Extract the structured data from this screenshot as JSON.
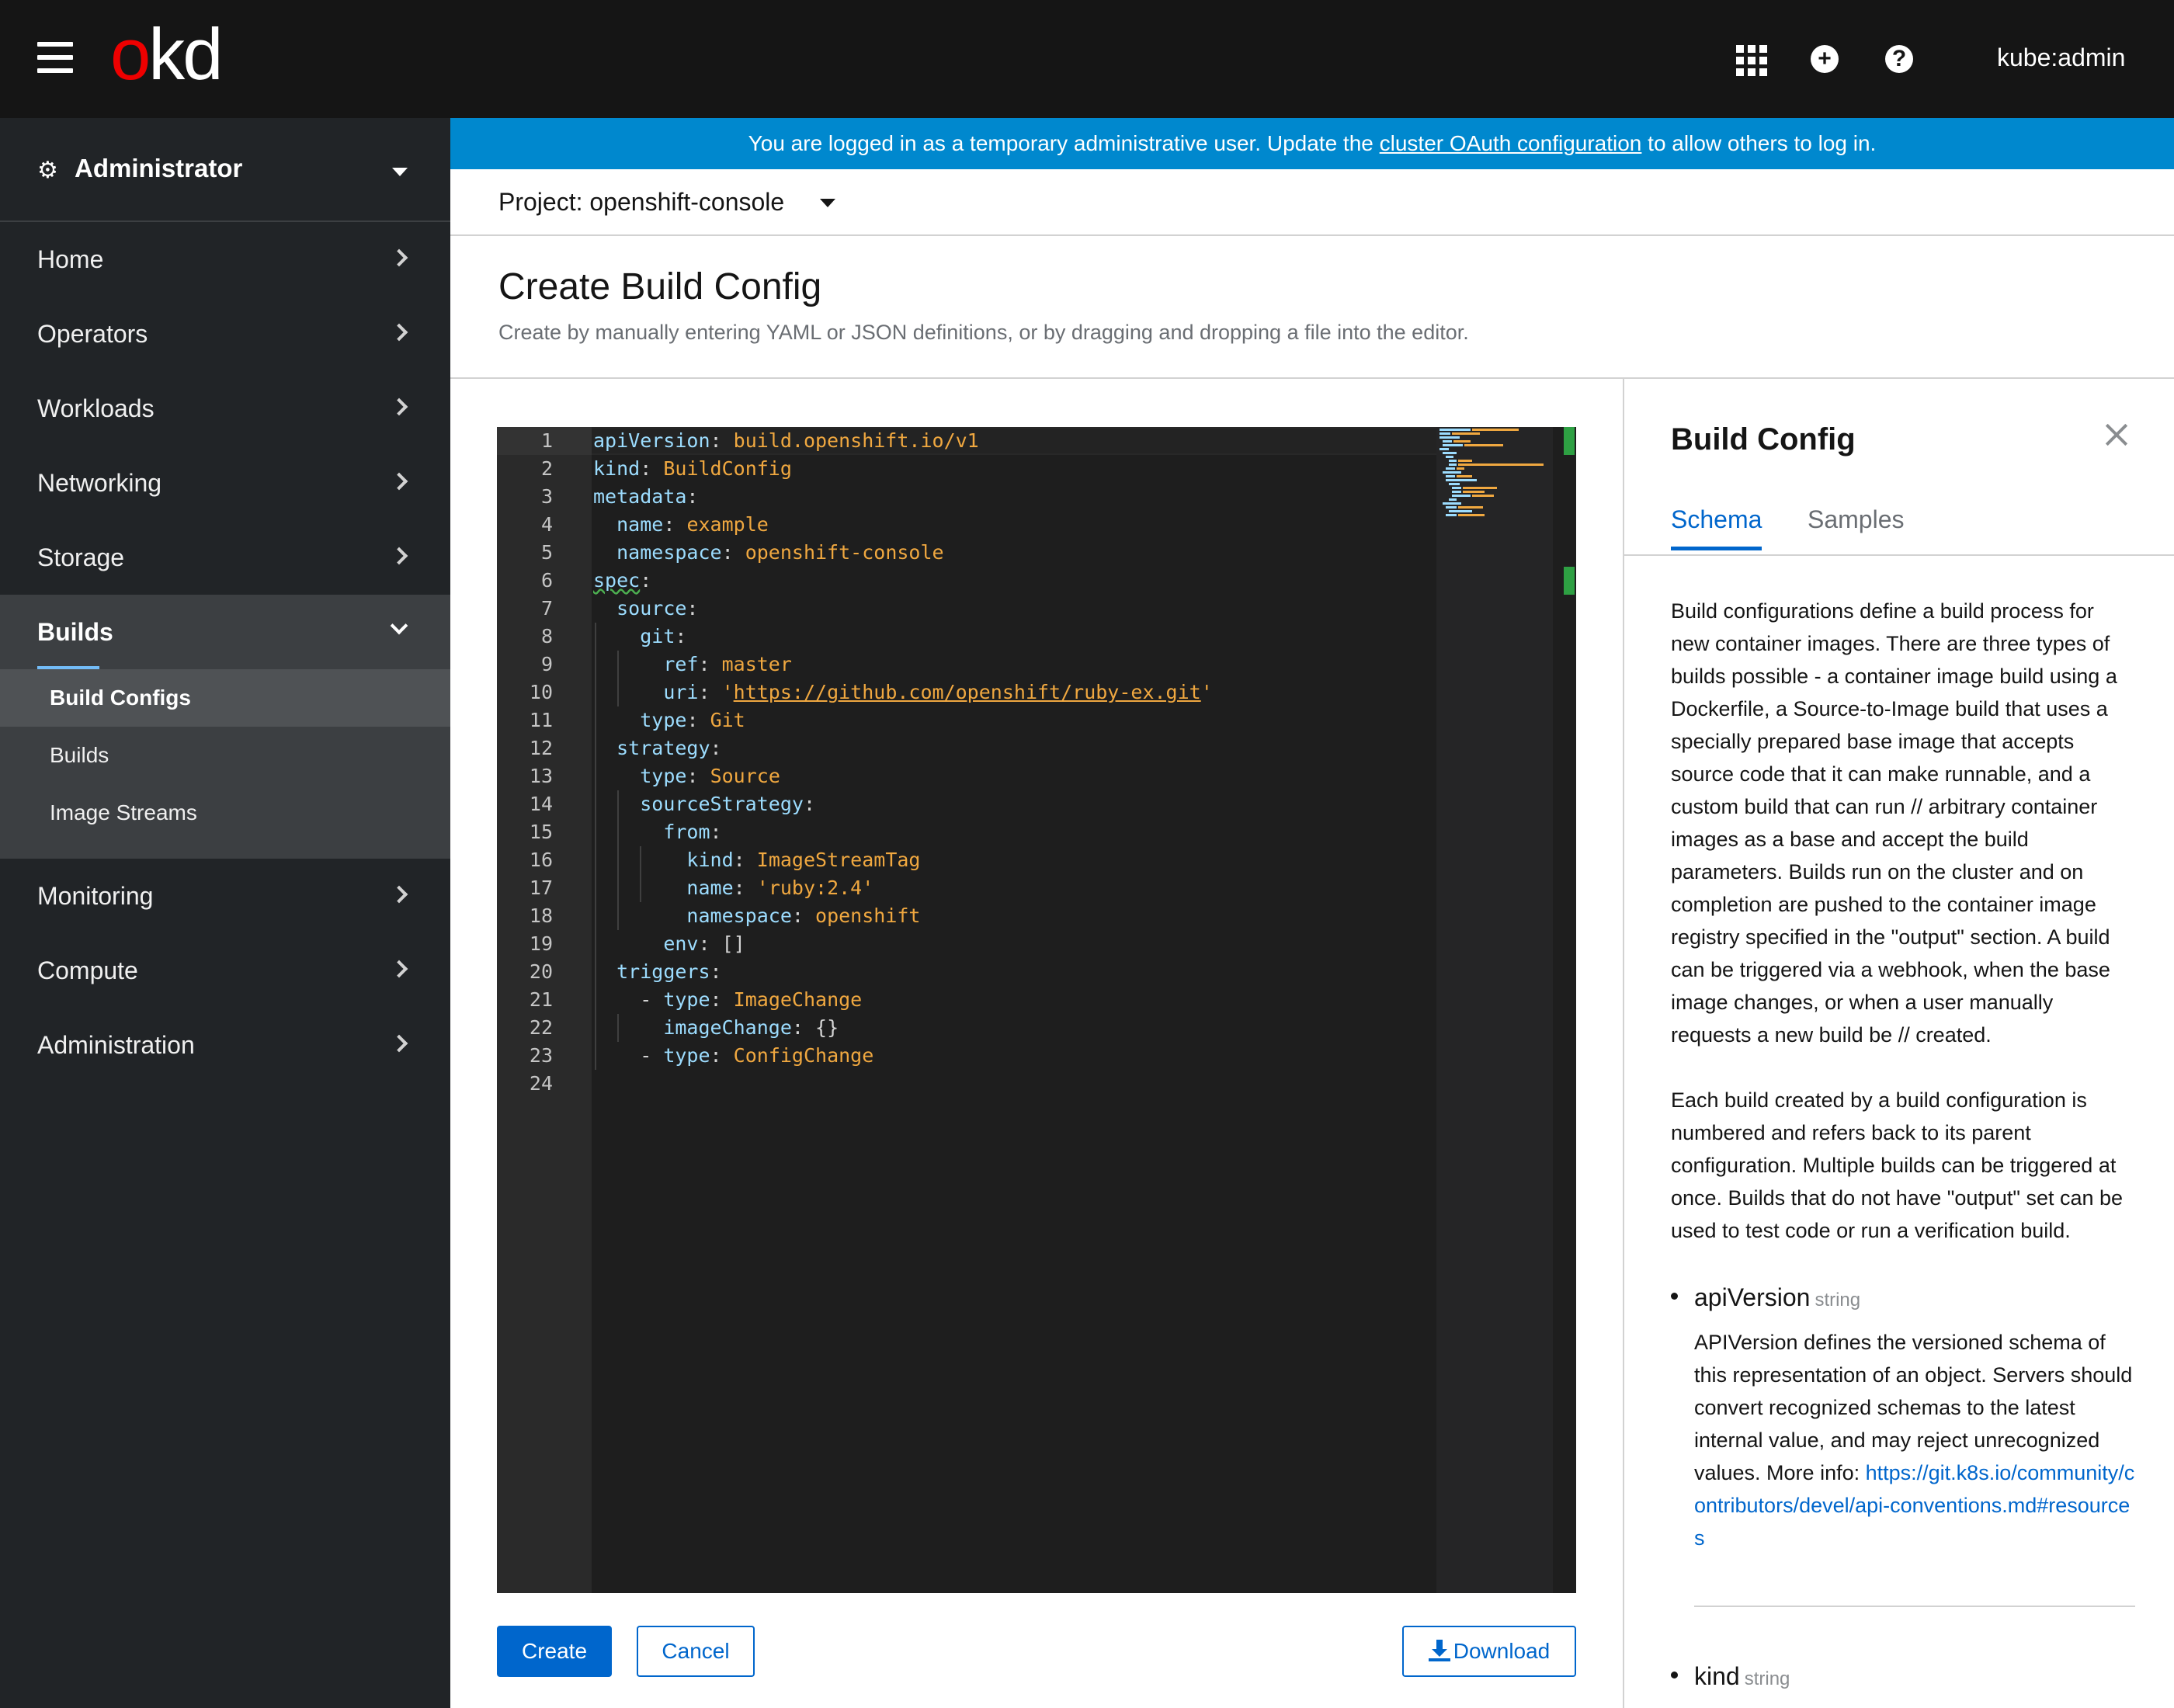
{
  "masthead": {
    "logo_o": "o",
    "logo_rest": "kd",
    "icons": [
      "hamburger-icon",
      "app-launcher-icon",
      "plus-circle-icon",
      "help-icon"
    ],
    "user": "kube:admin"
  },
  "sidebar": {
    "perspective": "Administrator",
    "items": [
      {
        "label": "Home"
      },
      {
        "label": "Operators"
      },
      {
        "label": "Workloads"
      },
      {
        "label": "Networking"
      },
      {
        "label": "Storage"
      },
      {
        "label": "Builds"
      },
      {
        "label": "Monitoring"
      },
      {
        "label": "Compute"
      },
      {
        "label": "Administration"
      }
    ],
    "builds_sub": [
      {
        "label": "Build Configs"
      },
      {
        "label": "Builds"
      },
      {
        "label": "Image Streams"
      }
    ]
  },
  "banner": {
    "text_before": "You are logged in as a temporary administrative user. Update the ",
    "link": "cluster OAuth configuration",
    "text_after": " to allow others to log in."
  },
  "project": {
    "label": "Project: openshift-console"
  },
  "page": {
    "title": "Create Build Config",
    "description": "Create by manually entering YAML or JSON definitions, or by dragging and dropping a file into the editor."
  },
  "editor": {
    "line_numbers": [
      "1",
      "2",
      "3",
      "4",
      "5",
      "6",
      "7",
      "8",
      "9",
      "10",
      "11",
      "12",
      "13",
      "14",
      "15",
      "16",
      "17",
      "18",
      "19",
      "20",
      "21",
      "22",
      "23",
      "24"
    ],
    "lines": {
      "l1_key": "apiVersion",
      "l1_val": "build.openshift.io/v1",
      "l2_key": "kind",
      "l2_val": "BuildConfig",
      "l3_key": "metadata",
      "l4_key": "name",
      "l4_val": "example",
      "l5_key": "namespace",
      "l5_val": "openshift-console",
      "l6_key": "spec",
      "l7_key": "source",
      "l8_key": "git",
      "l9_key": "ref",
      "l9_val": "master",
      "l10_key": "uri",
      "l10_q": "'",
      "l10_val": "https://github.com/openshift/ruby-ex.git",
      "l11_key": "type",
      "l11_val": "Git",
      "l12_key": "strategy",
      "l13_key": "type",
      "l13_val": "Source",
      "l14_key": "sourceStrategy",
      "l15_key": "from",
      "l16_key": "kind",
      "l16_val": "ImageStreamTag",
      "l17_key": "name",
      "l17_val": "'ruby:2.4'",
      "l18_key": "namespace",
      "l18_val": "openshift",
      "l19_key": "env",
      "l19_val": "[]",
      "l20_key": "triggers",
      "l21_key": "type",
      "l21_val": "ImageChange",
      "l22_key": "imageChange",
      "l22_val": "{}",
      "l23_key": "type",
      "l23_val": "ConfigChange",
      "colon": ":",
      "dash": "- "
    }
  },
  "buttons": {
    "create": "Create",
    "cancel": "Cancel",
    "download": "Download"
  },
  "side_panel": {
    "title": "Build Config",
    "tabs": [
      {
        "label": "Schema"
      },
      {
        "label": "Samples"
      }
    ],
    "paragraph1": "Build configurations define a build process for new container images. There are three types of builds possible - a container image build using a Dockerfile, a Source-to-Image build that uses a specially prepared base image that accepts source code that it can make runnable, and a custom build that can run // arbitrary container images as a base and accept the build parameters. Builds run on the cluster and on completion are pushed to the container image registry specified in the \"output\" section. A build can be triggered via a webhook, when the base image changes, or when a user manually requests a new build be // created.",
    "paragraph2": "Each build created by a build configuration is numbered and refers back to its parent configuration. Multiple builds can be triggered at once. Builds that do not have \"output\" set can be used to test code or run a verification build.",
    "fields": [
      {
        "name": "apiVersion",
        "type": "string",
        "description": "APIVersion defines the versioned schema of this representation of an object. Servers should convert recognized schemas to the latest internal value, and may reject unrecognized values. More info:",
        "link": "https://git.k8s.io/community/contributors/devel/api-conventions.md#resources"
      },
      {
        "name": "kind",
        "type": "string"
      }
    ]
  },
  "colors": {
    "masthead": "#151515",
    "sidebar": "#212427",
    "banner": "#0088ce",
    "primary": "#0066cc",
    "logo_red": "#ee0000",
    "yaml_key": "#9cdcfe",
    "yaml_value": "#f0a840"
  }
}
